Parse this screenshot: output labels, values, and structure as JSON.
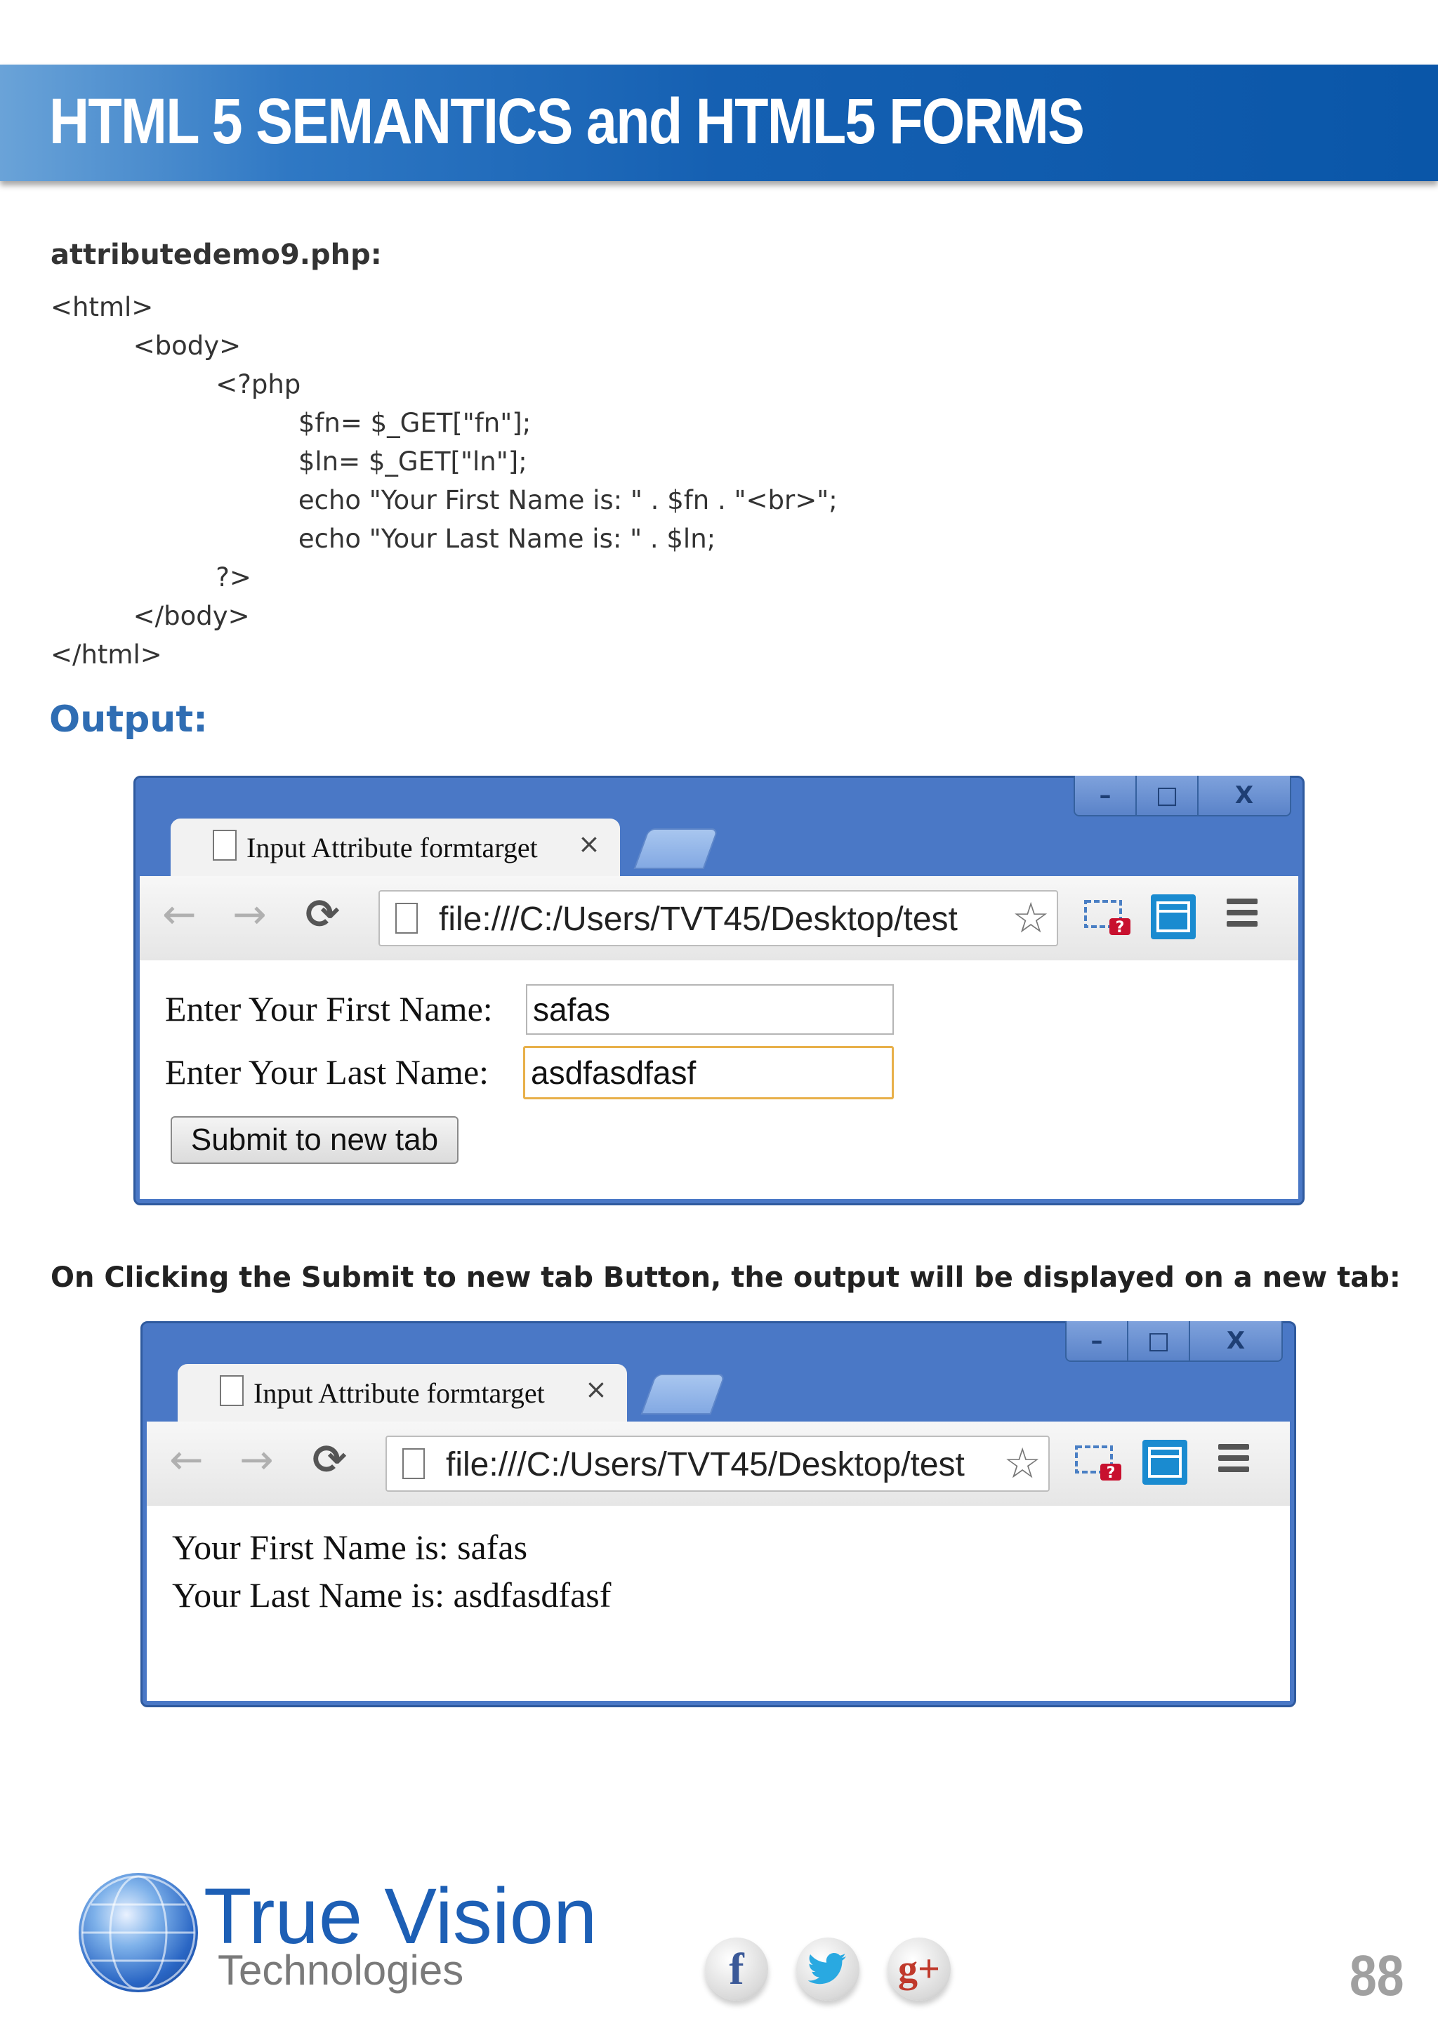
{
  "header": {
    "title": "HTML 5 SEMANTICS and HTML5 FORMS"
  },
  "file_title": "attributedemo9.php:",
  "code_lines": [
    "<html>",
    "          <body>",
    "                    <?php",
    "                              $fn= $_GET[\"fn\"];",
    "                              $ln= $_GET[\"ln\"];",
    "                              echo \"Your First Name is: \" . $fn . \"<br>\";",
    "                              echo \"Your Last Name is: \" . $ln;",
    "                    ?>",
    "          </body>",
    "</html>"
  ],
  "output_heading": "Output:",
  "browser1": {
    "window_buttons": {
      "minimize": "–",
      "maximize": "□",
      "close": "X"
    },
    "tab_title": "Input Attribute formtarget",
    "tab_close": "×",
    "url": "file:///C:/Users/TVT45/Desktop/test",
    "form": {
      "first_label": "Enter Your First Name:",
      "first_value": "safas",
      "last_label": "Enter Your Last Name:",
      "last_value": "asdfasdfasf",
      "submit_label": "Submit to new tab"
    }
  },
  "caption": "On Clicking the Submit to new tab Button, the output will be displayed on a new tab:",
  "browser2": {
    "window_buttons": {
      "minimize": "–",
      "maximize": "□",
      "close": "X"
    },
    "tab_title": "Input Attribute formtarget",
    "tab_close": "×",
    "url": "file:///C:/Users/TVT45/Desktop/test",
    "result_line1": "Your First Name is: safas",
    "result_line2": "Your Last Name is: asdfasdfasf"
  },
  "footer": {
    "logo_name": "True Vision",
    "logo_sub": "Technologies",
    "social": {
      "facebook": "f",
      "twitter": "t",
      "googleplus": "g+"
    },
    "page_number": "88"
  },
  "colors": {
    "header_blue": "#1560b2",
    "output_heading": "#2f6db3",
    "browser_frame": "#4a78c6"
  }
}
